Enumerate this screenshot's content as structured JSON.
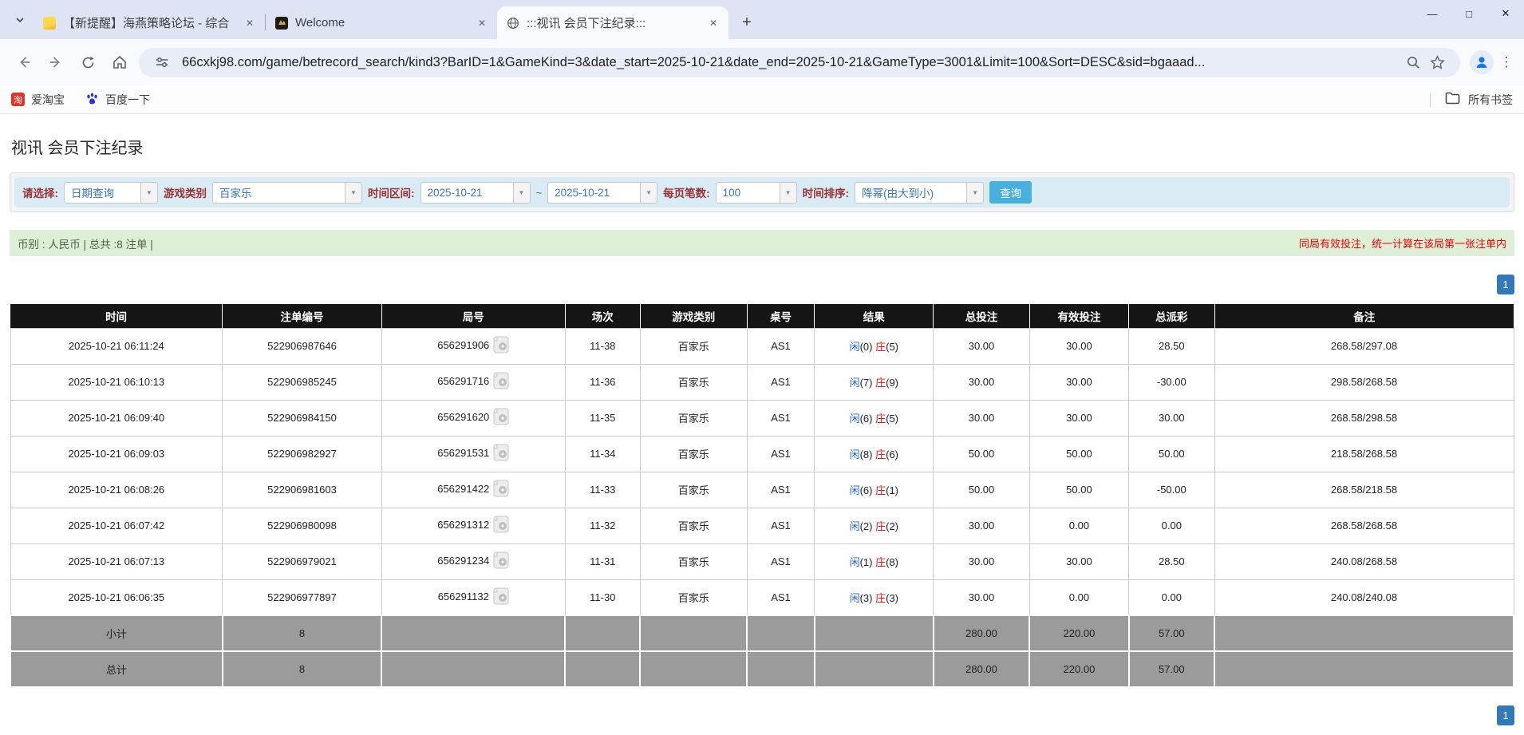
{
  "icons": {
    "close": "✕",
    "new_tab": "+",
    "minimize": "—",
    "maximize": "□",
    "menu": "⋮",
    "dropdown_arrow": "▼"
  },
  "browser": {
    "tabs": [
      {
        "title": "【新提醒】海燕策略论坛 - 综合",
        "active": false
      },
      {
        "title": "Welcome",
        "active": false
      },
      {
        "title": ":::视讯 会员下注纪录:::",
        "active": true
      }
    ],
    "url": "66cxkj98.com/game/betrecord_search/kind3?BarID=1&GameKind=3&date_start=2025-10-21&date_end=2025-10-21&GameType=3001&Limit=100&Sort=DESC&sid=bgaaad...",
    "bookmarks": [
      {
        "label": "爱淘宝",
        "badge": "淘"
      },
      {
        "label": "百度一下"
      }
    ],
    "all_bookmarks_label": "所有书签"
  },
  "page": {
    "title": "视讯 会员下注纪录",
    "filters": {
      "select_label": "请选择:",
      "select_value": "日期查询",
      "game_type_label": "游戏类别",
      "game_type_value": "百家乐",
      "date_range_label": "时间区间:",
      "date_start": "2025-10-21",
      "date_separator": "~",
      "date_end": "2025-10-21",
      "page_size_label": "每页笔数:",
      "page_size_value": "100",
      "sort_label": "时间排序:",
      "sort_value": "降幂(由大到小)",
      "search_button": "查询"
    },
    "summary": {
      "left": "币别 : 人民币 | 总共 :8 注单 |",
      "right_notice": "同局有效投注，统一计算在该局第一张注单内"
    },
    "pagination": {
      "page": "1"
    },
    "table": {
      "headers": [
        "时间",
        "注单编号",
        "局号",
        "场次",
        "游戏类别",
        "桌号",
        "结果",
        "总投注",
        "有效投注",
        "总派彩",
        "备注"
      ],
      "rows": [
        {
          "time": "2025-10-21 06:11:24",
          "bet_id": "522906987646",
          "round": "656291906",
          "session": "11-38",
          "game": "百家乐",
          "table_no": "AS1",
          "result_p": "闲",
          "result_pn": "(0)",
          "result_b": "庄",
          "result_bn": "(5)",
          "total_bet": "30.00",
          "valid_bet": "30.00",
          "payout": "28.50",
          "remark": "268.58/297.08"
        },
        {
          "time": "2025-10-21 06:10:13",
          "bet_id": "522906985245",
          "round": "656291716",
          "session": "11-36",
          "game": "百家乐",
          "table_no": "AS1",
          "result_p": "闲",
          "result_pn": "(7)",
          "result_b": "庄",
          "result_bn": "(9)",
          "total_bet": "30.00",
          "valid_bet": "30.00",
          "payout": "-30.00",
          "remark": "298.58/268.58"
        },
        {
          "time": "2025-10-21 06:09:40",
          "bet_id": "522906984150",
          "round": "656291620",
          "session": "11-35",
          "game": "百家乐",
          "table_no": "AS1",
          "result_p": "闲",
          "result_pn": "(6)",
          "result_b": "庄",
          "result_bn": "(5)",
          "total_bet": "30.00",
          "valid_bet": "30.00",
          "payout": "30.00",
          "remark": "268.58/298.58"
        },
        {
          "time": "2025-10-21 06:09:03",
          "bet_id": "522906982927",
          "round": "656291531",
          "session": "11-34",
          "game": "百家乐",
          "table_no": "AS1",
          "result_p": "闲",
          "result_pn": "(8)",
          "result_b": "庄",
          "result_bn": "(6)",
          "total_bet": "50.00",
          "valid_bet": "50.00",
          "payout": "50.00",
          "remark": "218.58/268.58"
        },
        {
          "time": "2025-10-21 06:08:26",
          "bet_id": "522906981603",
          "round": "656291422",
          "session": "11-33",
          "game": "百家乐",
          "table_no": "AS1",
          "result_p": "闲",
          "result_pn": "(6)",
          "result_b": "庄",
          "result_bn": "(1)",
          "total_bet": "50.00",
          "valid_bet": "50.00",
          "payout": "-50.00",
          "remark": "268.58/218.58"
        },
        {
          "time": "2025-10-21 06:07:42",
          "bet_id": "522906980098",
          "round": "656291312",
          "session": "11-32",
          "game": "百家乐",
          "table_no": "AS1",
          "result_p": "闲",
          "result_pn": "(2)",
          "result_b": "庄",
          "result_bn": "(2)",
          "total_bet": "30.00",
          "valid_bet": "0.00",
          "payout": "0.00",
          "remark": "268.58/268.58"
        },
        {
          "time": "2025-10-21 06:07:13",
          "bet_id": "522906979021",
          "round": "656291234",
          "session": "11-31",
          "game": "百家乐",
          "table_no": "AS1",
          "result_p": "闲",
          "result_pn": "(1)",
          "result_b": "庄",
          "result_bn": "(8)",
          "total_bet": "30.00",
          "valid_bet": "30.00",
          "payout": "28.50",
          "remark": "240.08/268.58"
        },
        {
          "time": "2025-10-21 06:06:35",
          "bet_id": "522906977897",
          "round": "656291132",
          "session": "11-30",
          "game": "百家乐",
          "table_no": "AS1",
          "result_p": "闲",
          "result_pn": "(3)",
          "result_b": "庄",
          "result_bn": "(3)",
          "total_bet": "30.00",
          "valid_bet": "0.00",
          "payout": "0.00",
          "remark": "240.08/240.08"
        }
      ],
      "subtotal": {
        "label": "小计",
        "count": "8",
        "total_bet": "280.00",
        "valid_bet": "220.00",
        "payout": "57.00"
      },
      "total": {
        "label": "总计",
        "count": "8",
        "total_bet": "280.00",
        "valid_bet": "220.00",
        "payout": "57.00"
      }
    }
  }
}
